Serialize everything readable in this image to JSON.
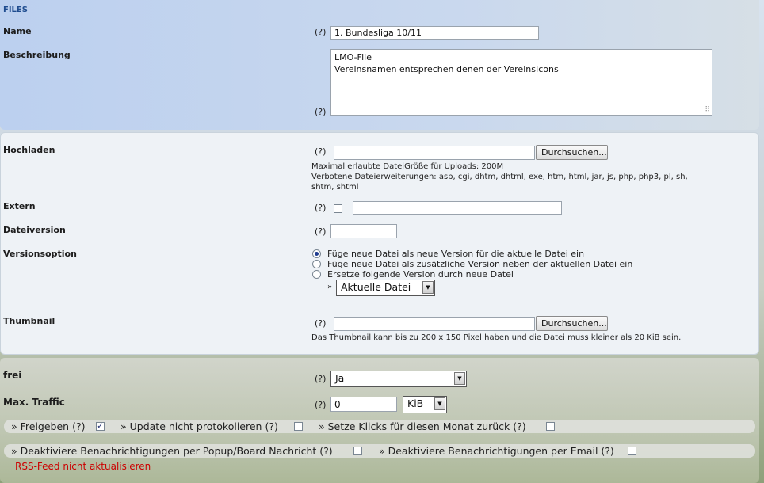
{
  "section_title": "FILES",
  "help_marker": "(?)",
  "name": {
    "label": "Name",
    "value": "1. Bundesliga 10/11"
  },
  "beschreibung": {
    "label": "Beschreibung",
    "line1": "LMO-File",
    "line2": "Vereinsnamen entsprechen denen der VereinsIcons"
  },
  "hochladen": {
    "label": "Hochladen",
    "browse": "Durchsuchen...",
    "max_size": "Maximal erlaubte DateiGröße für Uploads: 200M",
    "forbidden_line1": "Verbotene Dateierweiterungen: asp, cgi, dhtm, dhtml, exe, htm, html, jar, js, php, php3, pl, sh,",
    "forbidden_line2": "shtm, shtml"
  },
  "extern": {
    "label": "Extern"
  },
  "dateiversion": {
    "label": "Dateiversion"
  },
  "versionsoption": {
    "label": "Versionsoption",
    "options": [
      "Füge neue Datei als neue Version für die aktuelle Datei ein",
      "Füge neue Datei als zusätzliche Version neben der aktuellen Datei ein",
      "Ersetze folgende Version durch neue Datei"
    ],
    "selected_index": 0,
    "replace_select": "Aktuelle Datei"
  },
  "thumbnail": {
    "label": "Thumbnail",
    "browse": "Durchsuchen...",
    "hint": "Das Thumbnail kann bis zu 200 x 150 Pixel haben und die Datei muss kleiner als 20 KiB sein."
  },
  "frei": {
    "label": "frei",
    "value": "Ja"
  },
  "traffic": {
    "label": "Max. Traffic",
    "value": "0",
    "unit": "KiB"
  },
  "bar1": {
    "freigeben": "» Freigeben (?)",
    "update": "» Update nicht protokolieren (?)",
    "klicks": "» Setze Klicks für diesen Monat zurück (?)"
  },
  "bar2": {
    "popup": "» Deaktiviere Benachrichtigungen per Popup/Board Nachricht (?)",
    "email": "» Deaktiviere Benachrichtigungen per Email (?)"
  },
  "rss": "RSS-Feed nicht aktualisieren",
  "colors": {
    "header_blue": "#1f4c8f",
    "rss_red": "#cc0000",
    "top_panel": "#c5d6ef",
    "middle_panel": "#eef2f6"
  }
}
